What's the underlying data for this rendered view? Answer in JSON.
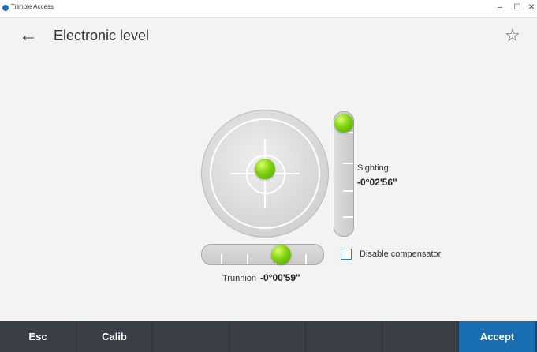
{
  "titlebar": {
    "app_title": "Trimble Access",
    "minimize": "–",
    "maximize": "☐",
    "close": "✕"
  },
  "header": {
    "back_glyph": "←",
    "title": "Electronic level",
    "favorite_glyph": "☆"
  },
  "levels": {
    "sighting_label": "Sighting",
    "sighting_value": "-0°02'56\"",
    "trunnion_label": "Trunnion",
    "trunnion_value": "-0°00'59\""
  },
  "compensator": {
    "label": "Disable compensator",
    "checked": false
  },
  "footer": {
    "keys": [
      "Esc",
      "Calib",
      "",
      "",
      "",
      "",
      "Accept"
    ]
  },
  "colors": {
    "bubble": "#7fd10f",
    "footer": "#3a3f47",
    "accept": "#1a6fb3",
    "checkbox": "#2f78c4"
  }
}
